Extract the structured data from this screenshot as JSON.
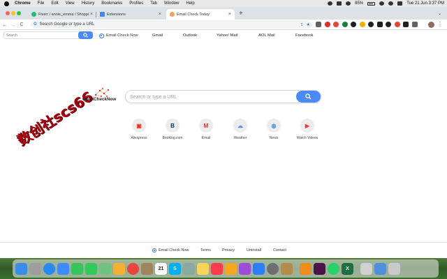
{
  "menubar": {
    "app": "Chrome",
    "items": [
      "File",
      "Edit",
      "View",
      "History",
      "Bookmarks",
      "Profiles",
      "Tab",
      "Window",
      "Help"
    ],
    "battery": "85%",
    "clock": "Tue 21 Jun  3:37 PM"
  },
  "tabs": [
    {
      "title": "Fiverr / annie_emma / Shoppin",
      "close": "×",
      "favicon_color": "#1dbf73"
    },
    {
      "title": "Extensions",
      "close": "×",
      "favicon_color": "#4285f4"
    },
    {
      "title": "Email Check Today",
      "close": "×",
      "favicon_color": "#f4a261"
    }
  ],
  "toolbar": {
    "back": "←",
    "forward": "→",
    "reload": "C",
    "omnibox_g": "G",
    "omnibox_placeholder": "Search Google or type a URL",
    "share": "⇪",
    "star": "★",
    "extension_colors": [
      "#5f6368",
      "#d93025",
      "#ea4335",
      "#188038",
      "#202124",
      "#f9ab00",
      "#202124",
      "#202124",
      "#202124",
      "#ea4335",
      "#202124",
      "#202124"
    ],
    "menu": "⋮"
  },
  "page": {
    "top_search": {
      "placeholder": "Search"
    },
    "quick_links": {
      "brand": "Email Check Now",
      "items": [
        "Gmail",
        "Outlook",
        "Yahoo! Mail",
        "AOL Mail",
        "Facebook"
      ]
    },
    "watermark": "数创社scs66",
    "logo_text": "emailCheckNow",
    "main_search": {
      "placeholder": "Search or type a URL"
    },
    "tiles": [
      {
        "label": "Aliexpress",
        "glyph": "▣",
        "color": "#e43225"
      },
      {
        "label": "Booking.com",
        "glyph": "B",
        "color": "#003580"
      },
      {
        "label": "Email",
        "glyph": "M",
        "color": "#d93025"
      },
      {
        "label": "Weather",
        "glyph": "☁",
        "color": "#5b8fd6"
      },
      {
        "label": "News",
        "glyph": "◍",
        "color": "#4a90e2"
      },
      {
        "label": "Watch Videos",
        "glyph": "▶",
        "color": "#e53935"
      }
    ]
  },
  "footer": {
    "brand": "Email Check Now",
    "links": [
      "Terms",
      "Privacy",
      "Uninstall",
      "Contact"
    ]
  },
  "dock": {
    "apps": [
      {
        "name": "Finder",
        "color": "#3a8ee6"
      },
      {
        "name": "Launchpad",
        "color": "#9e9e9e"
      },
      {
        "name": "Safari",
        "color": "#2b88f0"
      },
      {
        "name": "Mail",
        "color": "#3d8bfd"
      },
      {
        "name": "FaceTime",
        "color": "#36c55a"
      },
      {
        "name": "Messages",
        "color": "#34c759"
      },
      {
        "name": "Maps",
        "color": "#6fc37f"
      },
      {
        "name": "Photos",
        "color": "#f2b134"
      },
      {
        "name": "Chrome",
        "color": "#e8453c"
      },
      {
        "name": "Contacts",
        "color": "#a0845c"
      },
      {
        "name": "Calendar",
        "color": "#ffffff",
        "text": "21"
      },
      {
        "name": "Skype",
        "color": "#00aff0",
        "text": "S"
      },
      {
        "name": "Settings-gear",
        "color": "#8aa9a0"
      },
      {
        "name": "Notes",
        "color": "#f7d55b"
      },
      {
        "name": "Music",
        "color": "#fa3c4c"
      },
      {
        "name": "Pages",
        "color": "#f5a623"
      },
      {
        "name": "Podcasts",
        "color": "#9b4dd6"
      },
      {
        "name": "App Store",
        "color": "#2e7cf6"
      },
      {
        "name": "System Preferences",
        "color": "#6e6e73"
      },
      {
        "name": "Script Editor",
        "color": "#b38b4d"
      },
      {
        "name": "VLC",
        "color": "#f08c1a"
      },
      {
        "name": "Slack",
        "color": "#4a154b"
      },
      {
        "name": "WhatsApp",
        "color": "#25d366"
      },
      {
        "name": "Excel",
        "color": "#1d6f42",
        "text": "X"
      },
      {
        "name": "Preview",
        "color": "#d0d0d0"
      },
      {
        "name": "Downloads",
        "color": "#4f8fdc"
      },
      {
        "name": "Trash",
        "color": "#c9c9c9"
      }
    ]
  }
}
